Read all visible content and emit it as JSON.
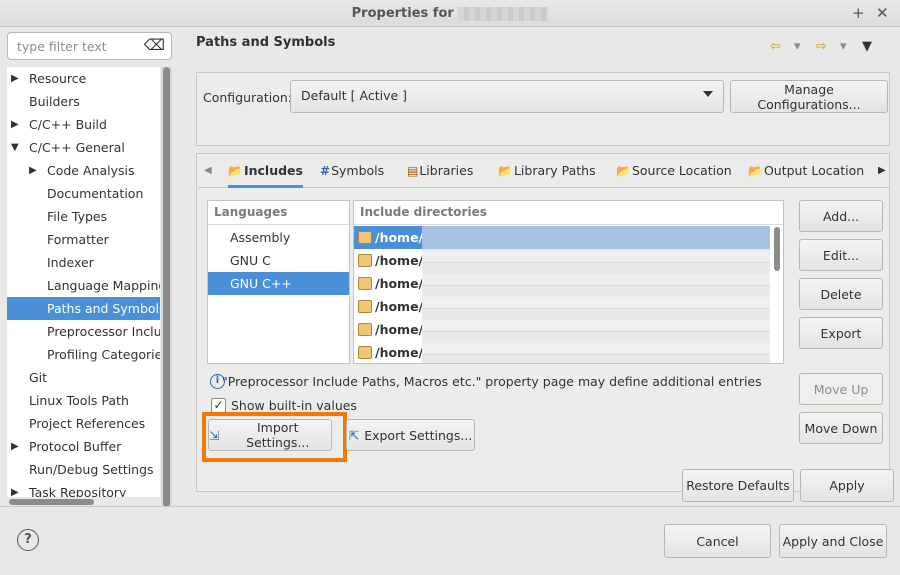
{
  "window": {
    "title": "Properties for",
    "add_glyph": "+",
    "close_glyph": "✕"
  },
  "filter": {
    "placeholder": "type filter text",
    "clear_glyph": "⌫"
  },
  "tree": [
    {
      "label": "Resource",
      "arrow": "▶"
    },
    {
      "label": "Builders",
      "arrow": ""
    },
    {
      "label": "C/C++ Build",
      "arrow": "▶"
    },
    {
      "label": "C/C++ General",
      "arrow": "▼"
    },
    {
      "label": "Code Analysis",
      "arrow": "▶"
    },
    {
      "label": "Documentation",
      "arrow": ""
    },
    {
      "label": "File Types",
      "arrow": ""
    },
    {
      "label": "Formatter",
      "arrow": ""
    },
    {
      "label": "Indexer",
      "arrow": ""
    },
    {
      "label": "Language Mappings",
      "arrow": ""
    },
    {
      "label": "Paths and Symbols",
      "arrow": "",
      "selected": true
    },
    {
      "label": "Preprocessor Includ",
      "arrow": ""
    },
    {
      "label": "Profiling Categories",
      "arrow": ""
    },
    {
      "label": "Git",
      "arrow": ""
    },
    {
      "label": "Linux Tools Path",
      "arrow": ""
    },
    {
      "label": "Project References",
      "arrow": ""
    },
    {
      "label": "Protocol Buffer",
      "arrow": "▶"
    },
    {
      "label": "Run/Debug Settings",
      "arrow": ""
    },
    {
      "label": "Task Repository",
      "arrow": "▶"
    }
  ],
  "page": {
    "title": "Paths and Symbols",
    "nav": {
      "back": "⇦",
      "forward": "⇨",
      "dropdown": "▾",
      "menu": "▼"
    }
  },
  "configuration": {
    "label": "Configuration:",
    "value": "Default  [ Active ]",
    "manage_label": "Manage Configurations..."
  },
  "tabs": [
    {
      "label": "Includes",
      "icon": "📂",
      "active": true
    },
    {
      "label": "Symbols",
      "icon": "#"
    },
    {
      "label": "Libraries",
      "icon": "▤"
    },
    {
      "label": "Library Paths",
      "icon": "📂"
    },
    {
      "label": "Source Location",
      "icon": "📂"
    },
    {
      "label": "Output Location",
      "icon": "📂"
    }
  ],
  "tab_scroll": {
    "left": "◀",
    "right": "▶"
  },
  "languages": {
    "header": "Languages",
    "items": [
      "Assembly",
      "GNU C",
      "GNU C++"
    ],
    "selected_index": 2
  },
  "include_dirs": {
    "header": "Include directories",
    "rows": [
      "/home/c",
      "/home/c",
      "/home/c",
      "/home/c",
      "/home/c",
      "/home/c"
    ]
  },
  "side_buttons": {
    "add": "Add...",
    "edit": "Edit...",
    "delete": "Delete",
    "export": "Export",
    "move_up": "Move Up",
    "move_down": "Move Down"
  },
  "info_text": "\"Preprocessor Include Paths, Macros etc.\" property page may define additional entries",
  "show_builtin": {
    "label": "Show built-in values",
    "checked": true,
    "check_glyph": "✓"
  },
  "import_settings": "Import Settings...",
  "export_settings": "Export Settings...",
  "restore_defaults": "Restore Defaults",
  "apply": "Apply",
  "footer": {
    "help_glyph": "?",
    "cancel": "Cancel",
    "apply_close": "Apply and Close"
  },
  "colors": {
    "selection": "#4a90d9",
    "highlight": "#f57900"
  }
}
